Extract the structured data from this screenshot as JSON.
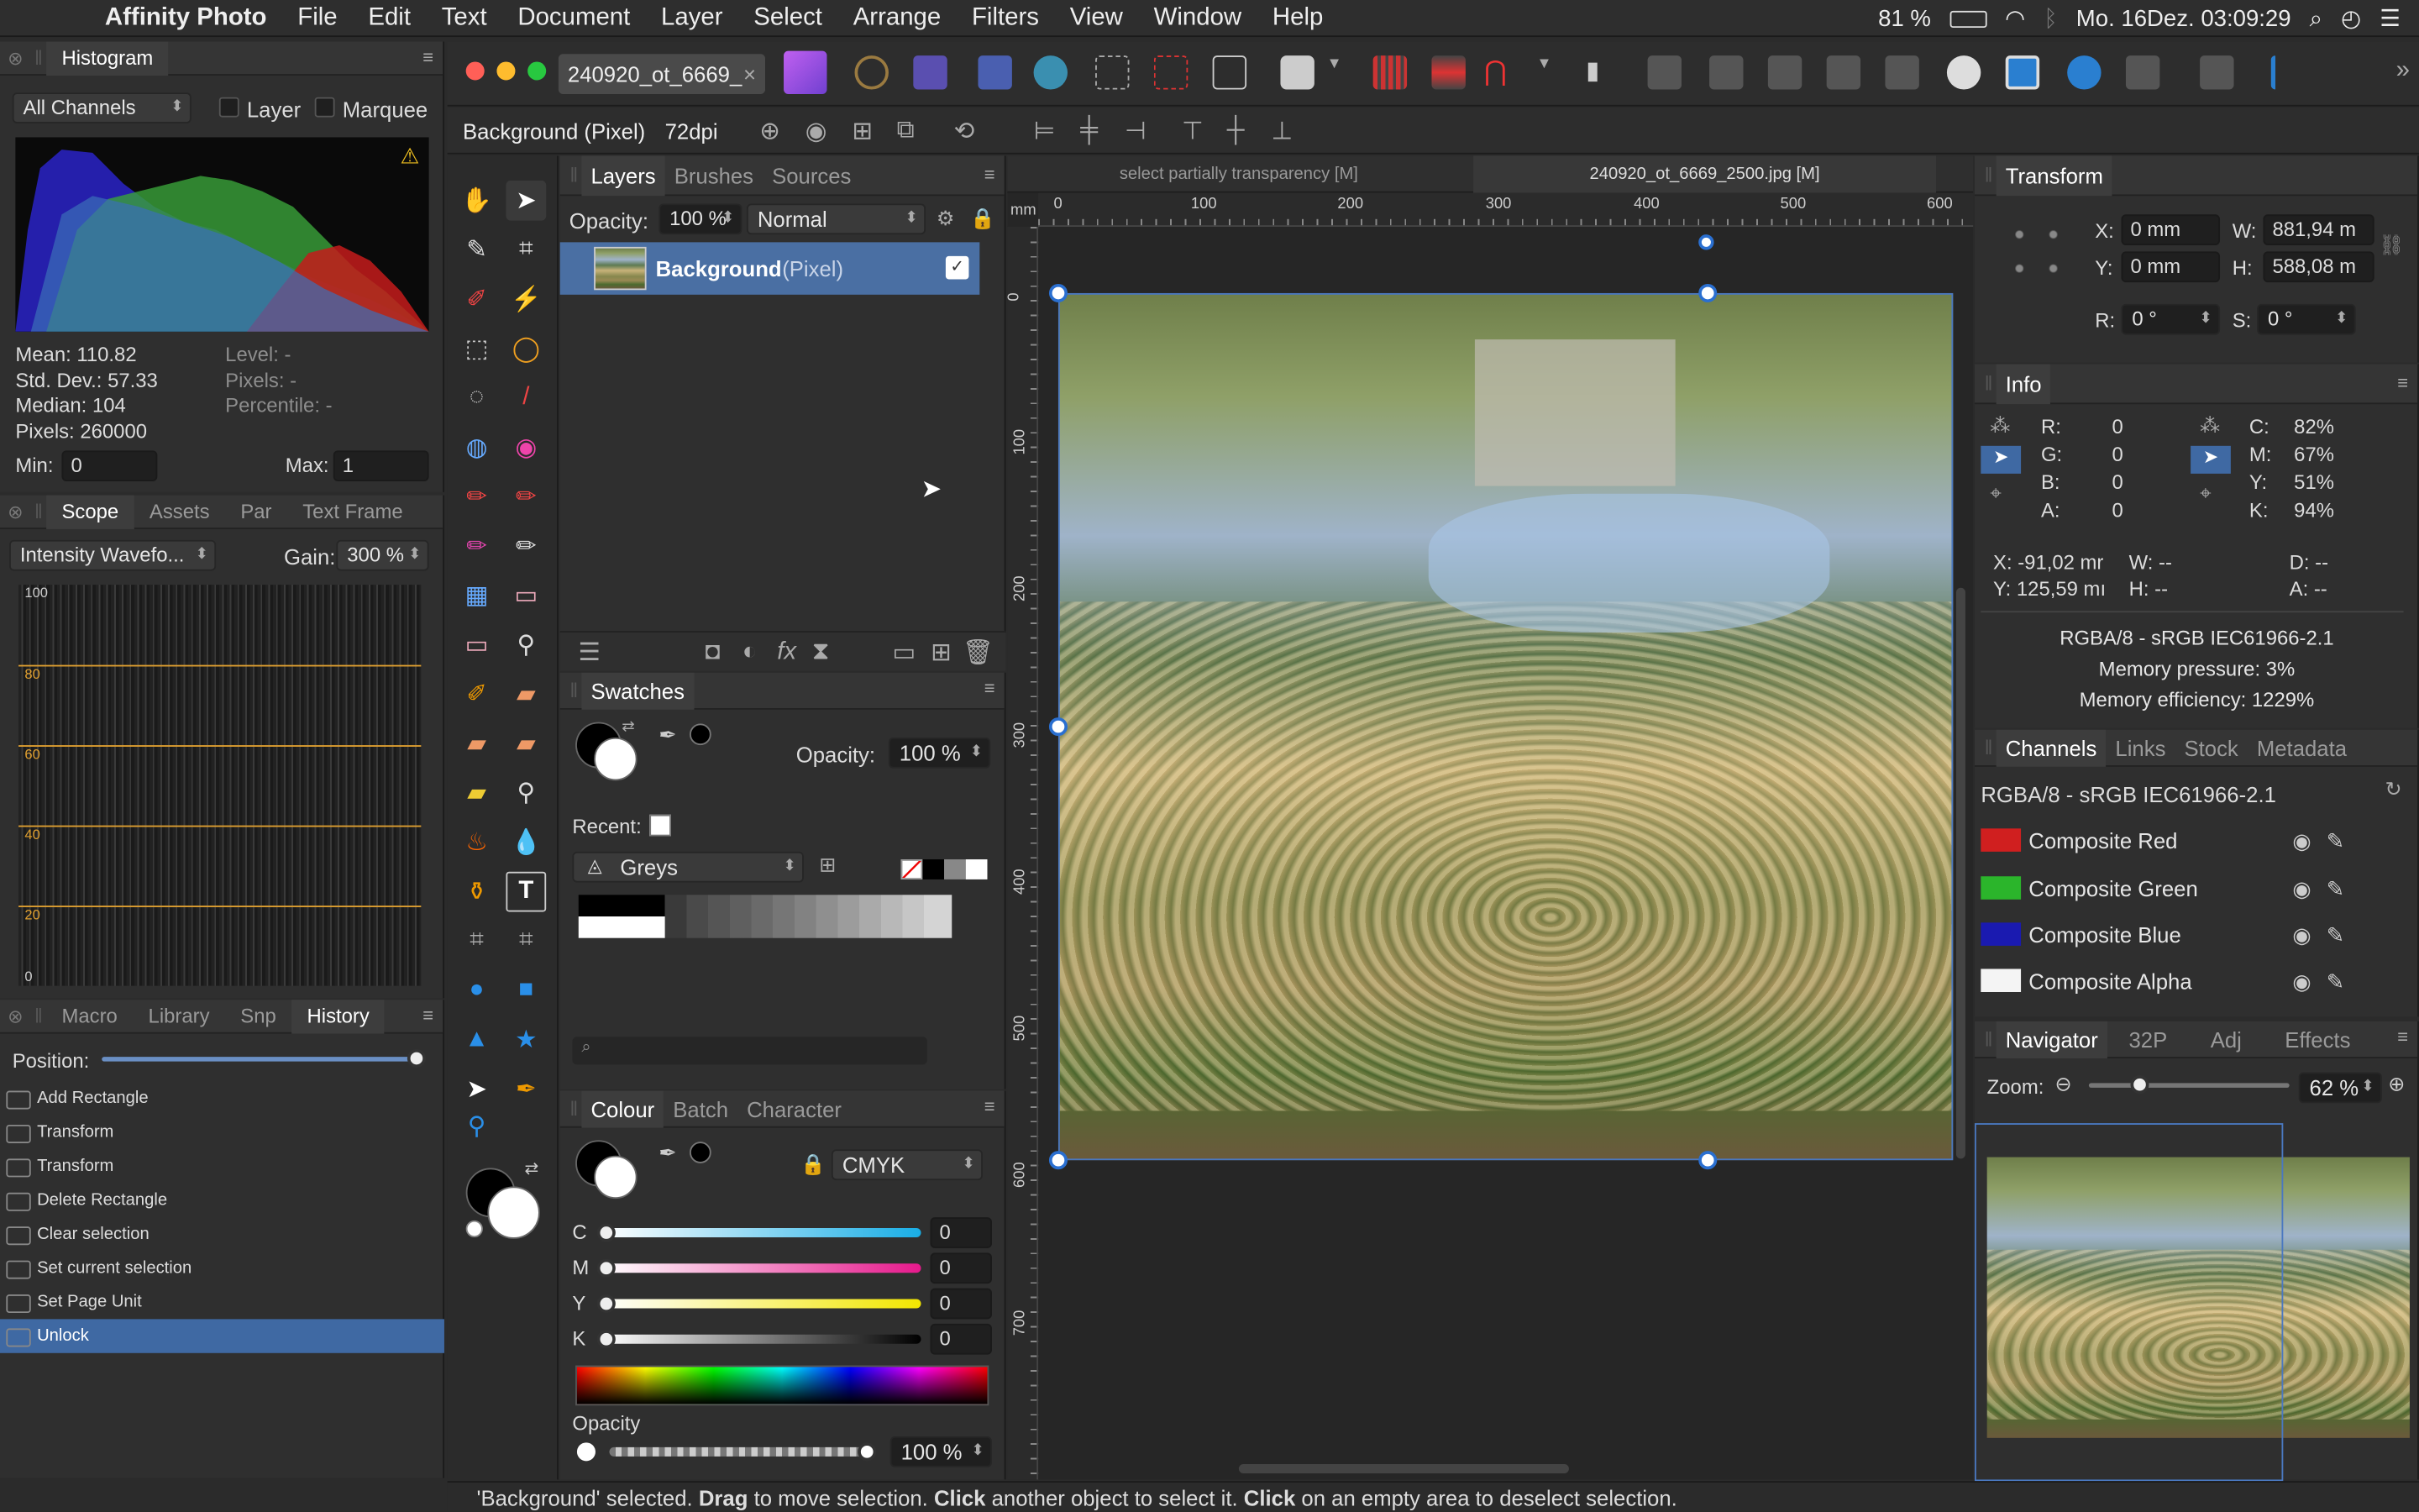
{
  "menubar": {
    "app": "Affinity Photo",
    "items": [
      "File",
      "Edit",
      "Text",
      "Document",
      "Layer",
      "Select",
      "Arrange",
      "Filters",
      "View",
      "Window",
      "Help"
    ],
    "battery": "81 %",
    "datetime": "Mo. 16Dez. 03:09:29"
  },
  "histogram": {
    "tab": "Histogram",
    "channel": "All Channels",
    "layer_label": "Layer",
    "marquee_label": "Marquee",
    "mean": "Mean: 110.82",
    "stddev": "Std. Dev.: 57.33",
    "median": "Median: 104",
    "pixels": "Pixels: 260000",
    "level": "Level: -",
    "pixels2": "Pixels: -",
    "percentile": "Percentile: -",
    "min_label": "Min:",
    "min_value": "0",
    "max_label": "Max:",
    "max_value": "1"
  },
  "scope": {
    "tabs": [
      "Scope",
      "Assets",
      "Par",
      "Text Frame"
    ],
    "mode": "Intensity Wavefo...",
    "gain_label": "Gain:",
    "gain_value": "300 %",
    "levels": [
      "100",
      "80",
      "60",
      "40",
      "20",
      "0"
    ]
  },
  "history": {
    "tabs": [
      "Macro",
      "Library",
      "Snp",
      "History"
    ],
    "position_label": "Position:",
    "items": [
      "Add Rectangle",
      "Transform",
      "Transform",
      "Delete Rectangle",
      "Clear selection",
      "Set current selection",
      "Set Page Unit",
      "Unlock"
    ]
  },
  "document": {
    "tab_title": "240920_ot_6669_",
    "context_layer": "Background (Pixel)",
    "dpi": "72dpi"
  },
  "layers": {
    "tabs": [
      "Layers",
      "Brushes",
      "Sources"
    ],
    "opacity_label": "Opacity:",
    "opacity_value": "100 %",
    "blend_mode": "Normal",
    "layer_name": "Background",
    "layer_type": "(Pixel)"
  },
  "swatches": {
    "tab": "Swatches",
    "opacity_label": "Opacity:",
    "opacity_value": "100 %",
    "recent_label": "Recent:",
    "palette": "Greys"
  },
  "colour": {
    "tabs": [
      "Colour",
      "Batch",
      "Character"
    ],
    "model": "CMYK",
    "channels": [
      {
        "name": "C",
        "value": "0"
      },
      {
        "name": "M",
        "value": "0"
      },
      {
        "name": "Y",
        "value": "0"
      },
      {
        "name": "K",
        "value": "0"
      }
    ],
    "opacity_label": "Opacity",
    "opacity_value": "100 %"
  },
  "canvas": {
    "tabs": [
      "select partially transparency [M]",
      "240920_ot_6669_2500.jpg [M]"
    ],
    "ruler_unit": "mm",
    "ruler_h": [
      "0",
      "100",
      "200",
      "300",
      "400",
      "500",
      "600"
    ],
    "ruler_v": [
      "0",
      "100",
      "200",
      "300",
      "400",
      "500",
      "600",
      "700"
    ]
  },
  "transform": {
    "tab": "Transform",
    "x_label": "X:",
    "x_value": "0 mm",
    "y_label": "Y:",
    "y_value": "0 mm",
    "w_label": "W:",
    "w_value": "881,94 m",
    "h_label": "H:",
    "h_value": "588,08 m",
    "r_label": "R:",
    "r_value": "0 °",
    "s_label": "S:",
    "s_value": "0 °"
  },
  "info": {
    "tab": "Info",
    "r": "R:",
    "r_v": "0",
    "g": "G:",
    "g_v": "0",
    "b": "B:",
    "b_v": "0",
    "a": "A:",
    "a_v": "0",
    "c": "C:",
    "c_v": "82%",
    "m": "M:",
    "m_v": "67%",
    "y": "Y:",
    "y_v": "51%",
    "k": "K:",
    "k_v": "94%",
    "x_pos": "X: -91,02 mr",
    "y_pos": "Y: 125,59 mı",
    "w_dash": "W: --",
    "h_dash": "H: --",
    "d_dash": "D: --",
    "a_dash": "A: --",
    "profile": "RGBA/8 - sRGB IEC61966-2.1",
    "memory_pressure": "Memory pressure: 3%",
    "memory_efficiency": "Memory efficiency: 1229%"
  },
  "channels": {
    "tabs": [
      "Channels",
      "Links",
      "Stock",
      "Metadata"
    ],
    "profile": "RGBA/8 - sRGB IEC61966-2.1",
    "items": [
      {
        "name": "Composite Red",
        "color": "#d01f1f"
      },
      {
        "name": "Composite Green",
        "color": "#2bb52b"
      },
      {
        "name": "Composite Blue",
        "color": "#1a1ab0"
      },
      {
        "name": "Composite Alpha",
        "color": "#f4f4f4"
      }
    ]
  },
  "navigator": {
    "tabs": [
      "Navigator",
      "32P",
      "Adj",
      "Effects"
    ],
    "zoom_label": "Zoom:",
    "zoom_value": "62 %"
  },
  "statusbar": {
    "p1": "'Background' selected. ",
    "b1": "Drag",
    "p2": " to move selection. ",
    "b2": "Click",
    "p3": " another object to select it. ",
    "b3": "Click",
    "p4": " on an empty area to deselect selection."
  }
}
